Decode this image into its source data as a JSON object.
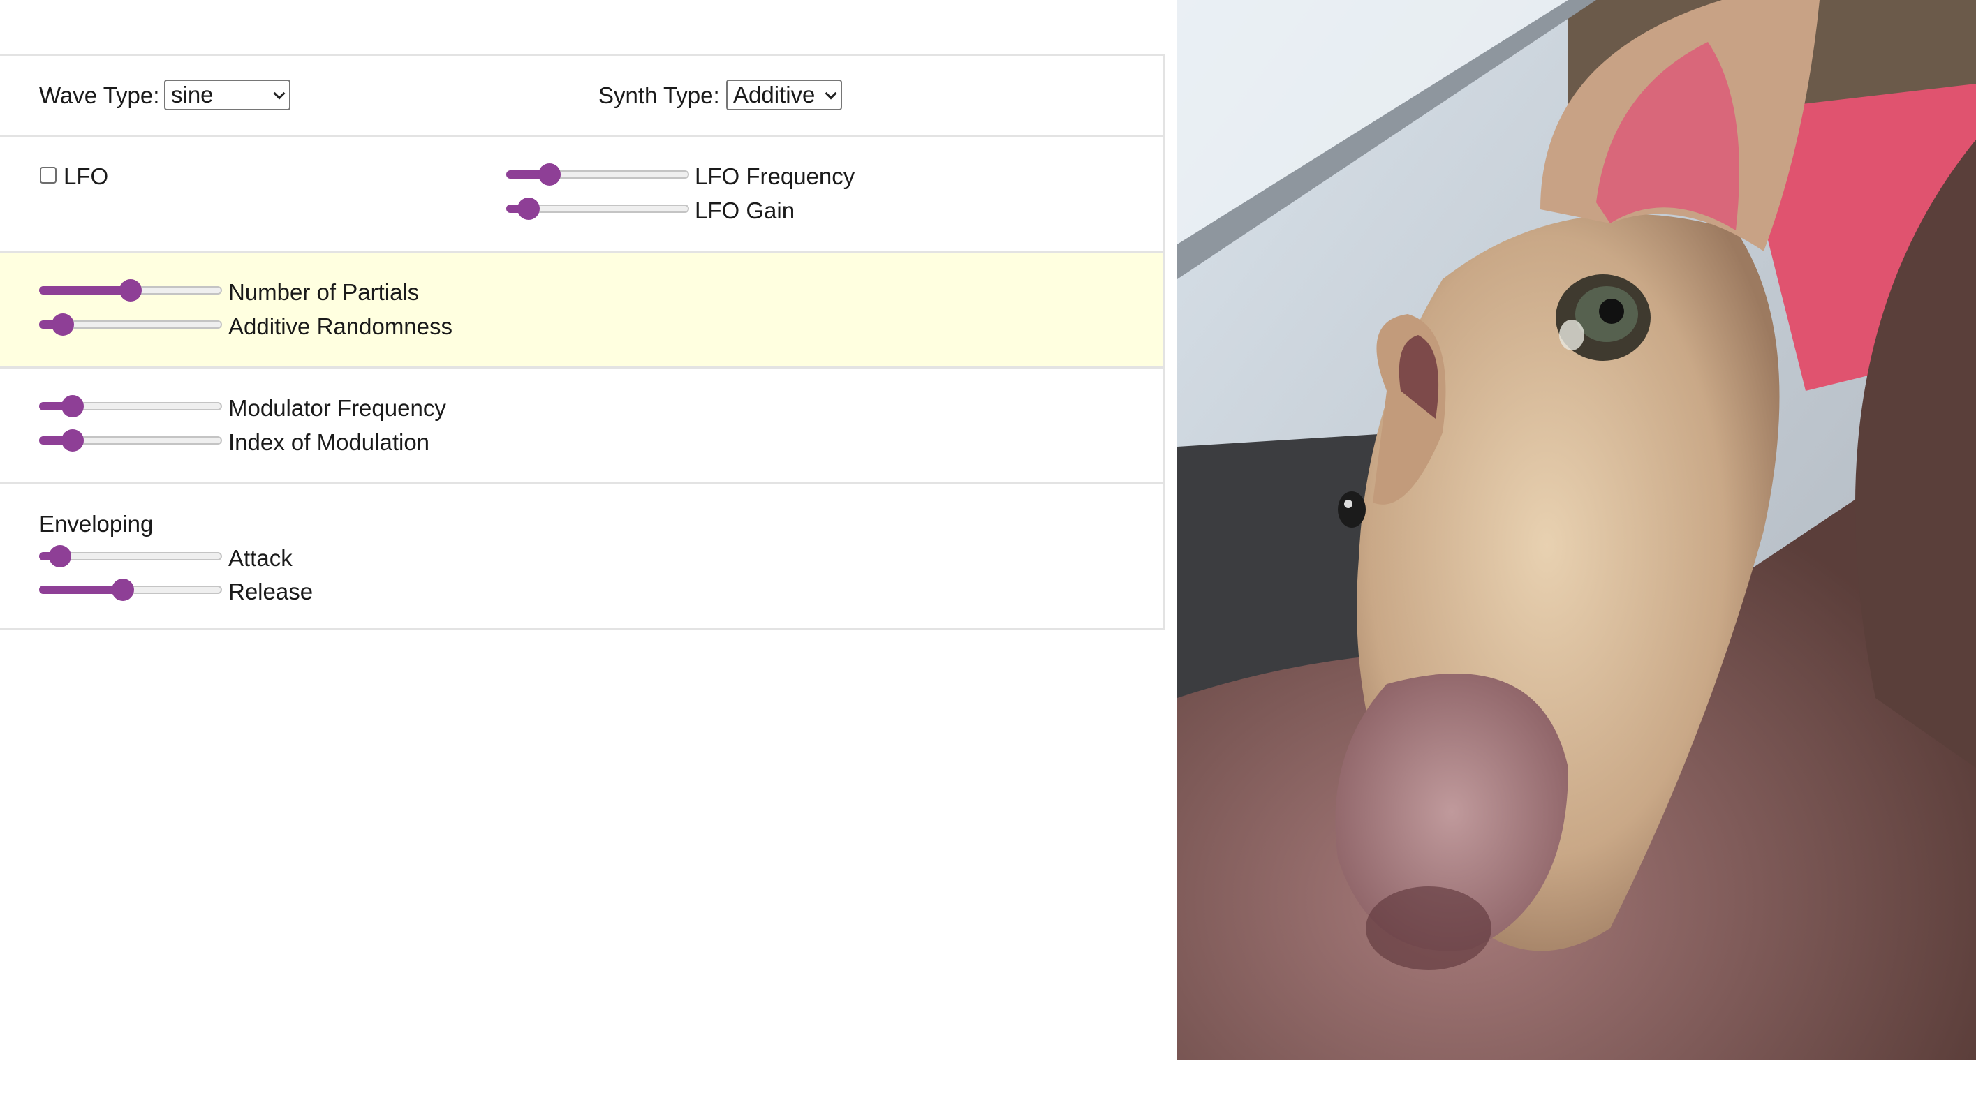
{
  "controls": {
    "wave_type": {
      "label": "Wave Type:",
      "value": "sine"
    },
    "synth_type": {
      "label": "Synth Type:",
      "value": "Additive"
    },
    "lfo": {
      "label": "LFO",
      "checked": false
    },
    "lfo_frequency": {
      "label": "LFO Frequency",
      "level": 0.2
    },
    "lfo_gain": {
      "label": "LFO Gain",
      "level": 0.07
    },
    "num_partials": {
      "label": "Number of Partials",
      "level": 0.5
    },
    "additive_randomness": {
      "label": "Additive Randomness",
      "level": 0.08
    },
    "modulator_frequency": {
      "label": "Modulator Frequency",
      "level": 0.14
    },
    "index_of_modulation": {
      "label": "Index of Modulation",
      "level": 0.14
    },
    "enveloping": {
      "label": "Enveloping"
    },
    "attack": {
      "label": "Attack",
      "level": 0.06
    },
    "release": {
      "label": "Release",
      "level": 0.45
    }
  },
  "colors": {
    "accent": "#8e3f96",
    "highlight_section": "#ffffe0"
  },
  "icons": {
    "select_arrow": "chevron-down-icon"
  },
  "photo": {
    "subject": "dog"
  }
}
